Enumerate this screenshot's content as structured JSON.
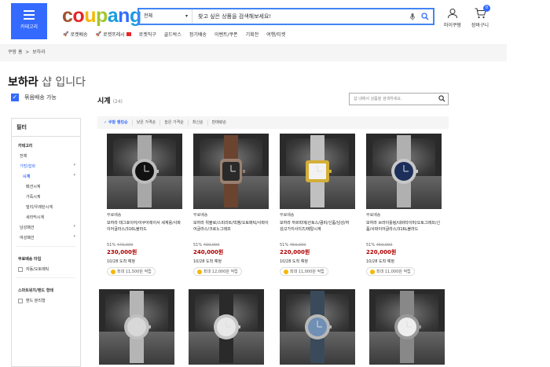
{
  "header": {
    "menu_label": "카테고리",
    "logo_letters": [
      "c",
      "o",
      "u",
      "p",
      "a",
      "n",
      "g"
    ],
    "logo_colors": [
      "#a0522d",
      "#e52528",
      "#f5b800",
      "#a3c62b",
      "#1b9ce0",
      "#346aff",
      "#1b9ce0"
    ],
    "search": {
      "category": "전체",
      "placeholder": "찾고 싶은 상품을 검색해보세요!"
    },
    "mycoupang_label": "마이쿠팡",
    "cart_label": "장바구니",
    "cart_count": "0"
  },
  "subnav": [
    {
      "label": "로켓배송",
      "icon": "rocket-icon"
    },
    {
      "label": "로켓프레시",
      "icon": "rocket-icon"
    },
    {
      "label": "로켓직구"
    },
    {
      "label": "골드박스"
    },
    {
      "label": "정기배송"
    },
    {
      "label": "이벤트/쿠폰"
    },
    {
      "label": "기획전"
    },
    {
      "label": "여행/티켓"
    }
  ],
  "breadcrumb": {
    "home": "쿠팡 홈",
    "separator": ">",
    "current": "보하라"
  },
  "shop": {
    "name": "보하라",
    "suffix": " 샵 입니다",
    "free_shipping_label": "묶음배송 가능"
  },
  "sidebar": {
    "title": "필터",
    "category_title": "카테고리",
    "categories": [
      {
        "label": "전체",
        "level": "level1",
        "state": ""
      },
      {
        "label": "가방/잡화",
        "level": "level1",
        "state": "active"
      },
      {
        "label": "시계",
        "level": "level2",
        "state": "active-bold"
      },
      {
        "label": "패션시계",
        "level": "level3",
        "state": ""
      },
      {
        "label": "가죽시계",
        "level": "level3",
        "state": ""
      },
      {
        "label": "빌리/우레탄시계",
        "level": "level3",
        "state": ""
      },
      {
        "label": "세라믹시계",
        "level": "level3",
        "state": ""
      },
      {
        "label": "남성패션",
        "level": "level1",
        "state": ""
      },
      {
        "label": "여성패션",
        "level": "level1",
        "state": ""
      }
    ],
    "shipping_title": "무료배송 타입",
    "shipping_option": "자동/오토매틱",
    "smartwatch_title": "스마트워치/밴드 형태",
    "smartwatch_option": "밴드 분리형"
  },
  "main": {
    "title": "시계",
    "count": "(24)",
    "search_placeholder": "샵 내에서 상품을 검색하세요.",
    "sort_options": [
      {
        "label": "✓ 쿠팡 랭킹순",
        "active": true
      },
      {
        "label": "낮은 가격순",
        "active": false
      },
      {
        "label": "높은 가격순",
        "active": false
      },
      {
        "label": "최신순",
        "active": false
      },
      {
        "label": "판매량순",
        "active": false
      }
    ]
  },
  "products": [
    {
      "free": "무료배송",
      "name": "보하라 태그호이어/아쿠아레이서 세계용/사파이어글라스/316L블라드",
      "discount": "51%",
      "original_price": "470,000",
      "price": "230,000원",
      "delivery": "10/28 도착 예정",
      "reward": "최대 11,500원 적립",
      "dial_color": "#111111",
      "case_color": "#bdbdbd",
      "band_color": "#a8a8a8"
    },
    {
      "free": "무료배송",
      "name": "보하라 위블로/스피리트/빅뱅/오토매틱/사파이어글라스/크로노그래프",
      "discount": "51%",
      "original_price": "490,000",
      "price": "240,000원",
      "delivery": "10/28 도착 예정",
      "reward": "최대 12,000원 적립",
      "dial_color": "#2a2a2a",
      "case_color": "#9a8070",
      "band_color": "#6b4430"
    },
    {
      "free": "무료배송",
      "name": "보하라 까르띠에/산토스/콤비/신품/남성/여성/2가지사이즈/메탈시계",
      "discount": "51%",
      "original_price": "450,000",
      "price": "220,000원",
      "delivery": "10/28 도착 예정",
      "reward": "최대 11,000원 적립",
      "dial_color": "#f2f2f2",
      "case_color": "#d4af37",
      "band_color": "#c0c0c0"
    },
    {
      "free": "무료배송",
      "name": "보하라 브라이틀링/네비타이머/오토그래프/신품/사파이어글라스/316L블라드",
      "discount": "51%",
      "original_price": "450,000",
      "price": "220,000원",
      "delivery": "10/28 도착 예정",
      "reward": "최대 11,000원 적립",
      "dial_color": "#1c2f5a",
      "case_color": "#c8c8c8",
      "band_color": "#b0b0b0"
    },
    {
      "dial_color": "#d8d8d8",
      "case_color": "#c0c0c0",
      "band_color": "#b5b5b5"
    },
    {
      "dial_color": "#e8e8e8",
      "case_color": "#c8c8c8",
      "band_color": "#2a2a2a"
    },
    {
      "dial_color": "#6f8fb5",
      "case_color": "#b8b8b8",
      "band_color": "#3a4a5a"
    },
    {
      "dial_color": "#eeeeee",
      "case_color": "#999999",
      "band_color": "#888888"
    }
  ]
}
